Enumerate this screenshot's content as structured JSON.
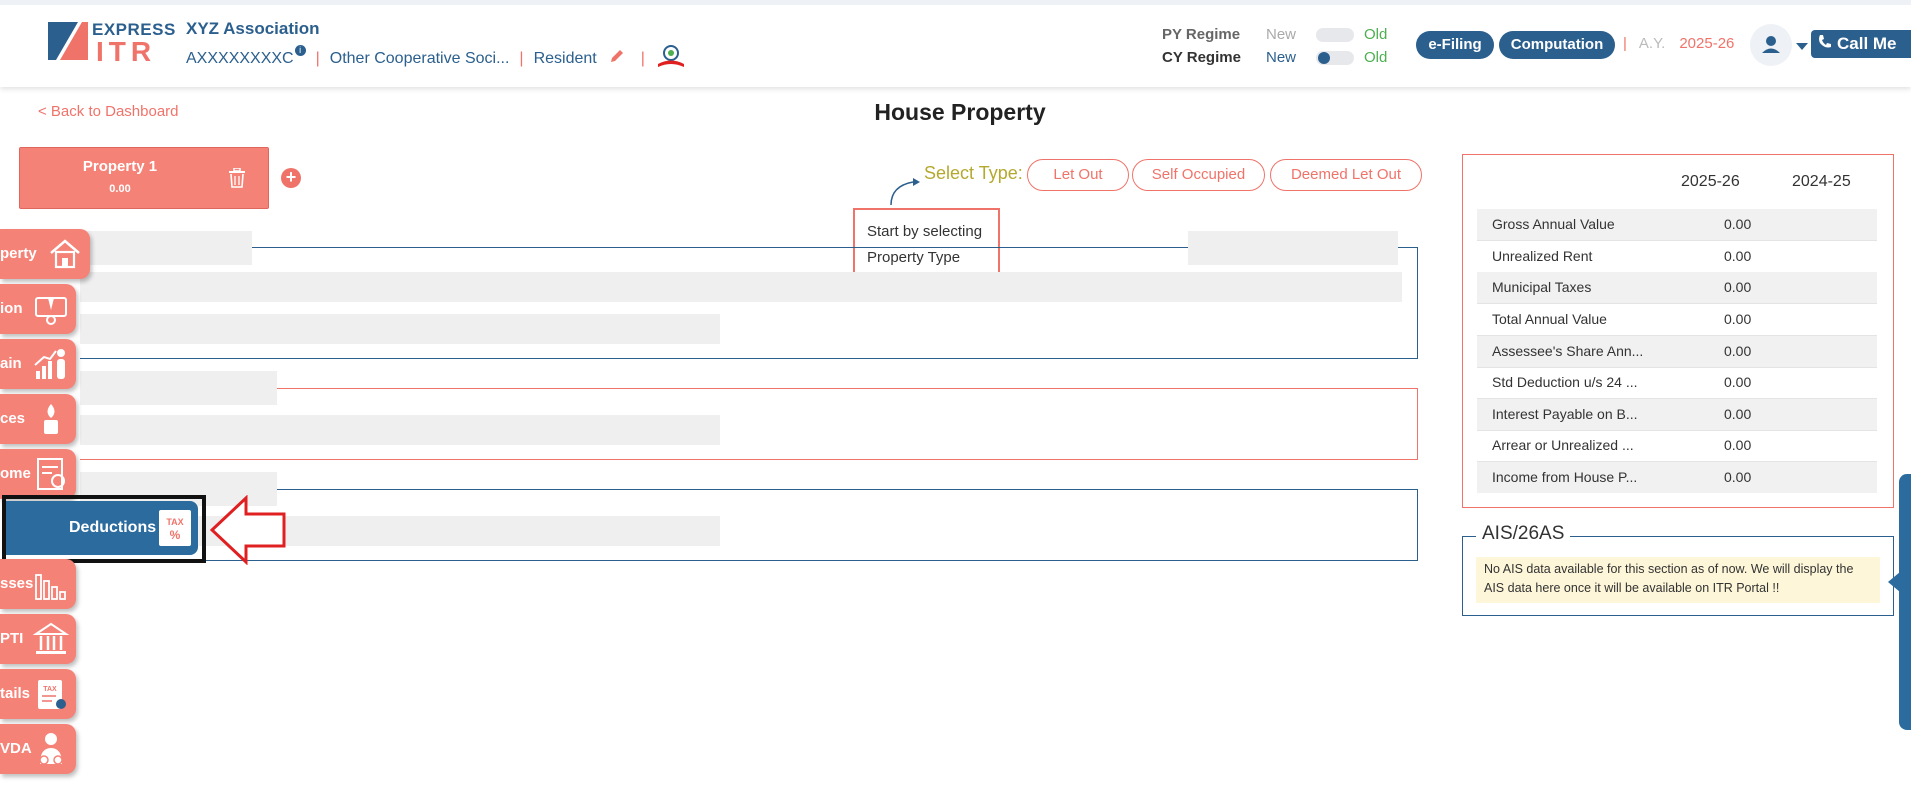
{
  "header": {
    "logo_top": "EXPRESS",
    "logo_bottom": "ITR",
    "org_name": "XYZ Association",
    "pan": "AXXXXXXXXC",
    "info_icon": "i",
    "entity_type": "Other Cooperative Soci...",
    "residency": "Resident",
    "py_regime_label": "PY Regime",
    "cy_regime_label": "CY Regime",
    "new_label": "New",
    "old_label": "Old",
    "efiling_label": "e-Filing",
    "computation_label": "Computation",
    "ay_label": "A.Y.",
    "ay_value": "2025-26",
    "call_me_label": "Call Me"
  },
  "main": {
    "back_link": "< Back to Dashboard",
    "title": "House Property",
    "property_card": {
      "title": "Property 1",
      "value": "0.00"
    },
    "select_type_label": "Select Type:",
    "type_options": [
      "Let Out",
      "Self Occupied",
      "Deemed Let Out"
    ],
    "tooltip_line1": "Start by selecting",
    "tooltip_line2": "Property Type"
  },
  "sidebar": {
    "items": [
      {
        "label": "perty",
        "icon": "house-icon"
      },
      {
        "label": "ion",
        "icon": "salary-icon"
      },
      {
        "label": "ain",
        "icon": "capital-gain-icon"
      },
      {
        "label": "ces",
        "icon": "other-sources-icon"
      },
      {
        "label": "ome",
        "icon": "tax-document-icon"
      },
      {
        "label": "Deductions",
        "icon": "tax-percent-icon",
        "active": true
      },
      {
        "label": "sses",
        "icon": "losses-chart-icon"
      },
      {
        "label": "PTI",
        "icon": "bank-icon"
      },
      {
        "label": "tails",
        "icon": "tax-clipboard-icon"
      },
      {
        "label": "VDA",
        "icon": "vda-person-icon"
      }
    ]
  },
  "summary": {
    "col1": "2025-26",
    "col2": "2024-25",
    "rows": [
      {
        "label": "Gross Annual Value",
        "value": "0.00"
      },
      {
        "label": "Unrealized Rent",
        "value": "0.00"
      },
      {
        "label": "Municipal Taxes",
        "value": "0.00"
      },
      {
        "label": "Total Annual Value",
        "value": "0.00"
      },
      {
        "label": "Assessee's Share Ann...",
        "value": "0.00"
      },
      {
        "label": "Std Deduction u/s 24 ...",
        "value": "0.00"
      },
      {
        "label": "Interest Payable on B...",
        "value": "0.00"
      },
      {
        "label": "Arrear or Unrealized ...",
        "value": "0.00"
      },
      {
        "label": "Income from House P...",
        "value": "0.00"
      }
    ]
  },
  "ais": {
    "title": "AIS/26AS",
    "message": "No AIS data available for this section as of now. We will display the AIS data here once it will be available on ITR Portal !!"
  },
  "colors": {
    "primary": "#2b5f8e",
    "accent": "#f0736a",
    "nav_tab": "#f58277",
    "active_tab": "#2b6b9e",
    "highlight_arrow": "#e02020"
  }
}
